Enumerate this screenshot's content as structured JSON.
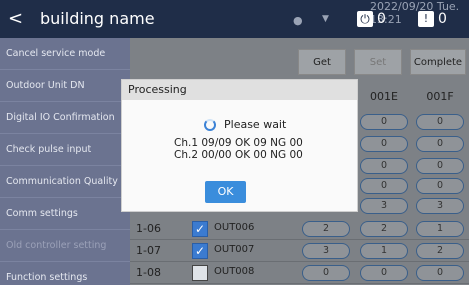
{
  "topbar": {
    "back": "<",
    "title": "building name",
    "datetime": "2022/09/20 Tue. 13:21",
    "power_count": "0",
    "warning_count": "0"
  },
  "sidebar": {
    "items": [
      "Cancel service mode",
      "Outdoor Unit DN",
      "Digital IO Confirmation",
      "Check pulse input",
      "Communication Quality",
      "Comm settings",
      "Old controller setting",
      "Function settings"
    ]
  },
  "content": {
    "buttons": {
      "get": "Get",
      "set": "Set",
      "complete": "Complete"
    },
    "columns": [
      "001E",
      "001F"
    ],
    "rows": [
      {
        "id": "1-06",
        "checked": true,
        "name": "OUT006",
        "v1": "2",
        "v2": "2",
        "v3": "1"
      },
      {
        "id": "1-07",
        "checked": true,
        "name": "OUT007",
        "v1": "3",
        "v2": "1",
        "v3": "2"
      },
      {
        "id": "1-08",
        "checked": false,
        "name": "OUT008",
        "v1": "0",
        "v2": "0",
        "v3": "0"
      }
    ],
    "partial_pills": [
      "0",
      "0",
      "0",
      "0",
      "3"
    ],
    "partial_pills2": [
      "0",
      "0",
      "0",
      "0",
      "3"
    ]
  },
  "dialog": {
    "title": "Processing",
    "wait": "Please wait",
    "ch1": "Ch.1  09/09   OK 09   NG 00",
    "ch2": "Ch.2  00/00   OK 00   NG 00",
    "ok": "OK"
  }
}
